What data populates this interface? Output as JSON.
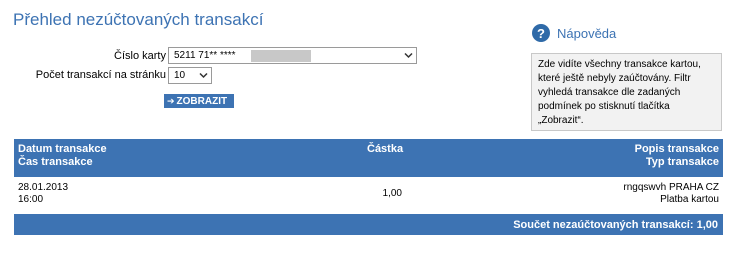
{
  "page": {
    "title": "Přehled nezúčtovaných transakcí"
  },
  "filter": {
    "card_label": "Číslo karty",
    "card_value": "5211 71** ****",
    "count_label": "Počet transakcí na stránku",
    "count_value": "10",
    "show_button_label": "ZOBRAZIT"
  },
  "help": {
    "title": "Nápověda",
    "icon": "question-icon",
    "text": "Zde vidíte všechny transakce kartou, které ještě nebyly zaúčtovány. Filtr vyhledá transakce dle zadaných podmínek po stisknutí tlačítka „Zobrazit“."
  },
  "table": {
    "headers": {
      "date": "Datum transakce",
      "time": "Čas transakce",
      "amount": "Částka",
      "description": "Popis transakce",
      "type": "Typ transakce"
    },
    "rows": [
      {
        "date": "28.01.2013",
        "time": "16:00",
        "amount": "1,00",
        "description": "rngqswvh PRAHA CZ",
        "type": "Platba kartou"
      }
    ],
    "footer": "Součet nezaúčtovaných transakcí: 1,00"
  },
  "colors": {
    "brand_blue": "#3d73b3",
    "help_icon_blue": "#2f6aa8",
    "help_box_bg": "#f2f2f2"
  }
}
